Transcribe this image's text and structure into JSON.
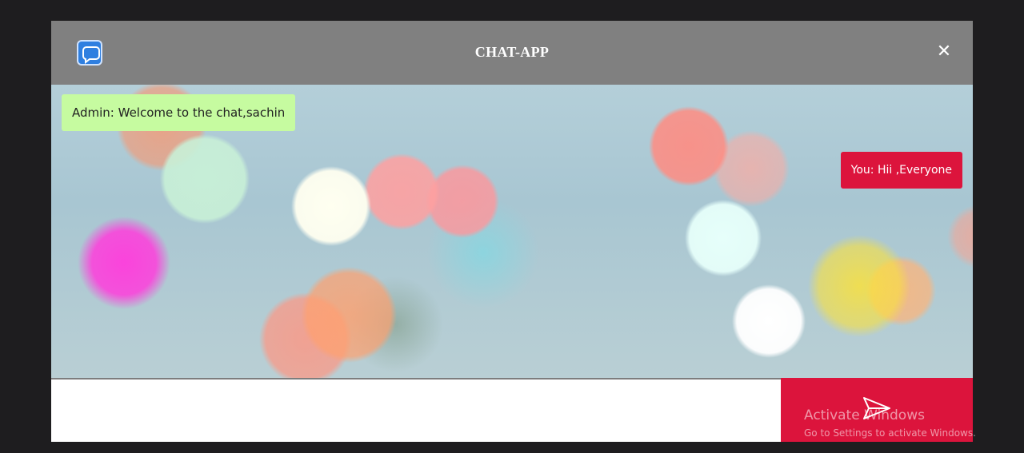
{
  "header": {
    "title": "CHAT-APP",
    "logo_icon": "chat-bubble-icon",
    "close_label": "✕",
    "background": "#808080"
  },
  "messages": [
    {
      "sender": "admin",
      "text": "Admin: Welcome to the chat,sachin",
      "color": "#c6fba0"
    },
    {
      "sender": "you",
      "text": "You: Hii ,Everyone",
      "color": "#dc143c"
    }
  ],
  "composer": {
    "value": "",
    "placeholder": "",
    "send_icon": "send-paper-plane-icon",
    "send_color": "#dc143c"
  },
  "watermark": {
    "title": "Activate Windows",
    "subtitle": "Go to Settings to activate Windows."
  }
}
